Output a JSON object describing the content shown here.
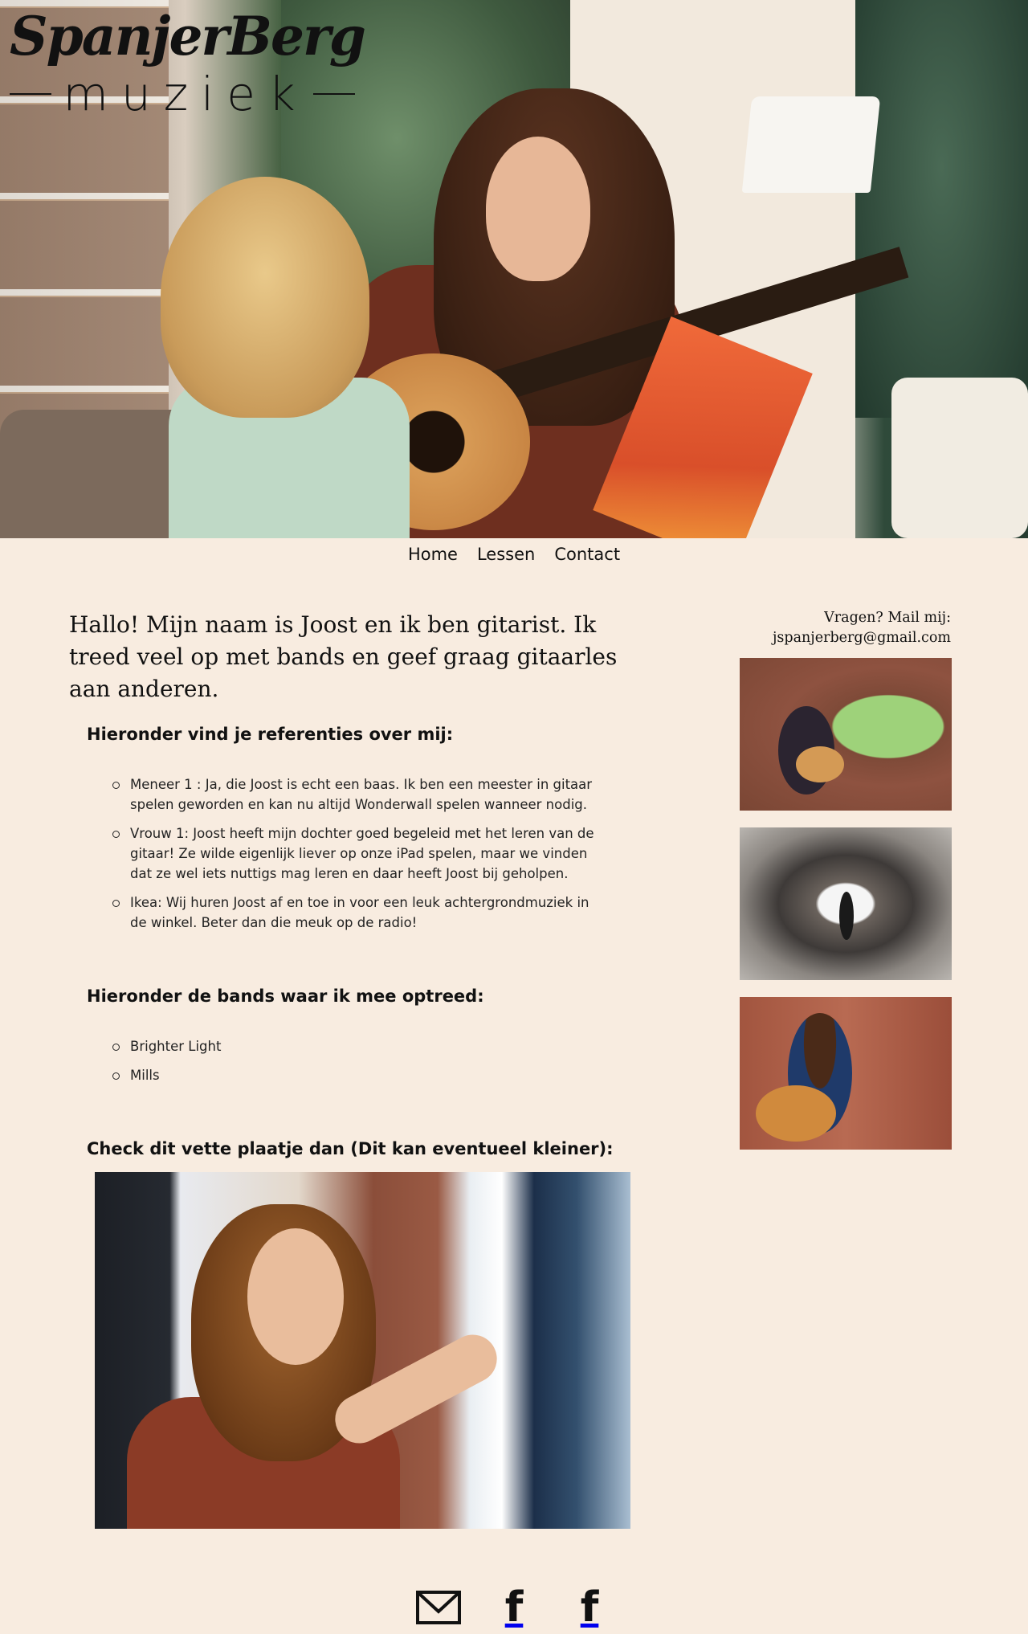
{
  "logo": {
    "script_text": "SpanjerBerg",
    "sub_text": "muziek"
  },
  "nav": {
    "items": [
      {
        "label": "Home"
      },
      {
        "label": "Lessen"
      },
      {
        "label": "Contact"
      }
    ]
  },
  "main": {
    "intro": "Hallo! Mijn naam is Joost en ik ben gitarist. Ik treed veel op met bands en geef graag gitaarles aan anderen.",
    "references_heading": "Hieronder vind je referenties over mij:",
    "references": [
      "Meneer 1 : Ja, die Joost is echt een baas. Ik ben een meester in gitaar spelen geworden en kan nu altijd Wonderwall spelen wanneer nodig.",
      "Vrouw 1: Joost heeft mijn dochter goed begeleid met het leren van de gitaar! Ze wilde eigenlijk liever op onze iPad spelen, maar we vinden dat ze wel iets nuttigs mag leren en daar heeft Joost bij geholpen.",
      "Ikea: Wij huren Joost af en toe in voor een leuk achtergrondmuziek in de winkel. Beter dan die meuk op de radio!"
    ],
    "bands_heading": "Hieronder de bands waar ik mee optreed:",
    "bands": [
      "Brighter Light",
      "Mills"
    ],
    "photo_heading": "Check dit vette plaatje dan (Dit kan eventueel kleiner):"
  },
  "sidebar": {
    "contact_line1": "Vragen? Mail mij:",
    "contact_email": "jspanjerberg@gmail.com"
  },
  "footer": {
    "icons": [
      "mail-icon",
      "facebook-icon",
      "facebook-icon"
    ]
  }
}
